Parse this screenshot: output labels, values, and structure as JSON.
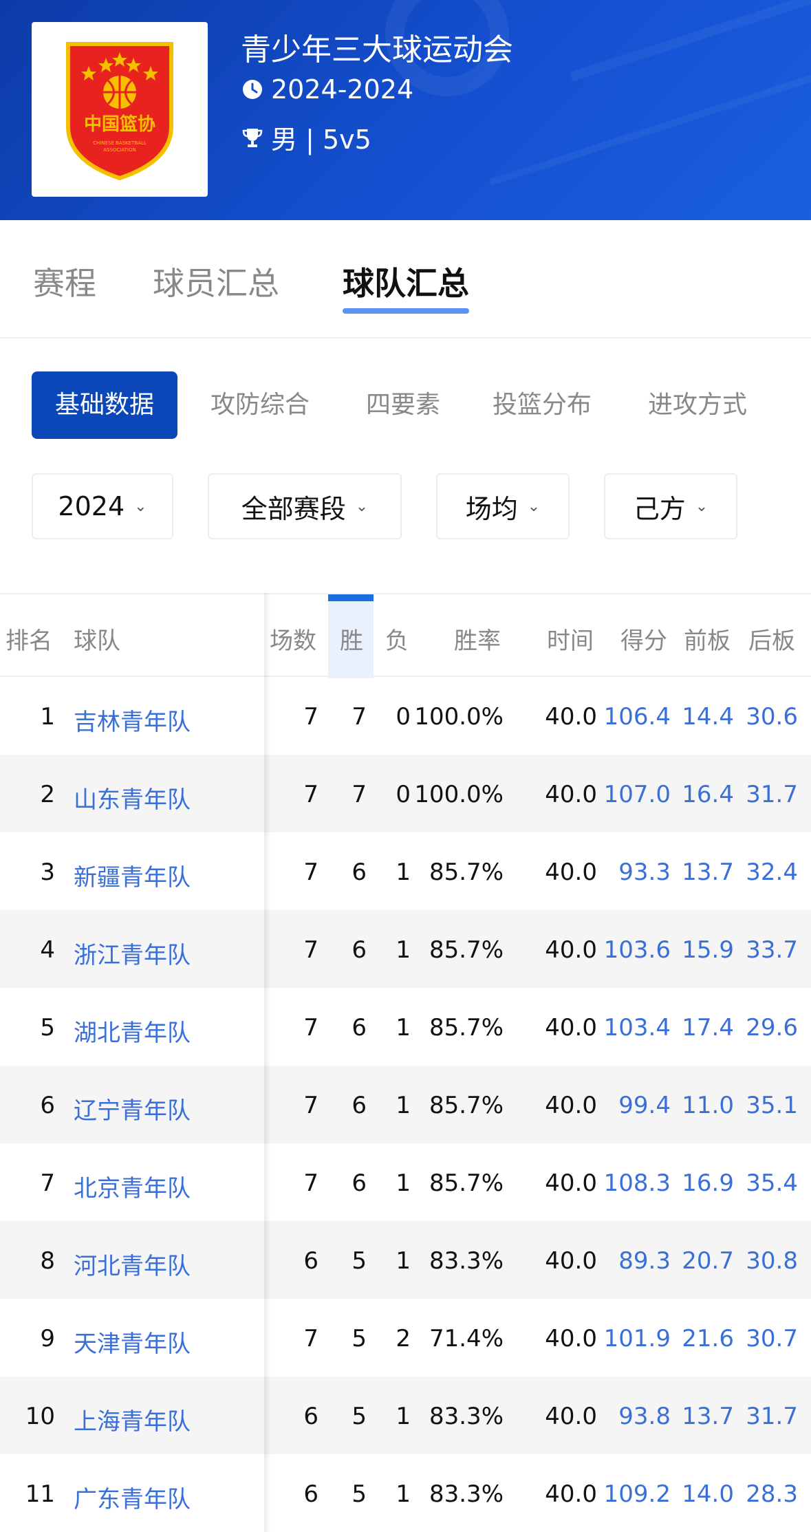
{
  "header": {
    "title": "青少年三大球运动会",
    "season": "2024-2024",
    "category": "男 | 5v5",
    "logo_text": "中国篮协",
    "logo_subtext": "CHINESE BASKETBALL ASSOCIATION"
  },
  "main_tabs": [
    {
      "label": "赛程",
      "active": false
    },
    {
      "label": "球员汇总",
      "active": false
    },
    {
      "label": "球队汇总",
      "active": true
    }
  ],
  "sub_tabs": [
    {
      "label": "基础数据",
      "active": true
    },
    {
      "label": "攻防综合",
      "active": false
    },
    {
      "label": "四要素",
      "active": false
    },
    {
      "label": "投篮分布",
      "active": false
    },
    {
      "label": "进攻方式",
      "active": false
    }
  ],
  "filters": [
    {
      "value": "2024"
    },
    {
      "value": "全部赛段"
    },
    {
      "value": "场均"
    },
    {
      "value": "己方"
    }
  ],
  "table": {
    "columns": [
      "排名",
      "球队",
      "场数",
      "胜",
      "负",
      "胜率",
      "时间",
      "得分",
      "前板",
      "后板"
    ],
    "rows": [
      [
        "1",
        "吉林青年队",
        "7",
        "7",
        "0",
        "100.0%",
        "40.0",
        "106.4",
        "14.4",
        "30.6"
      ],
      [
        "2",
        "山东青年队",
        "7",
        "7",
        "0",
        "100.0%",
        "40.0",
        "107.0",
        "16.4",
        "31.7"
      ],
      [
        "3",
        "新疆青年队",
        "7",
        "6",
        "1",
        "85.7%",
        "40.0",
        "93.3",
        "13.7",
        "32.4"
      ],
      [
        "4",
        "浙江青年队",
        "7",
        "6",
        "1",
        "85.7%",
        "40.0",
        "103.6",
        "15.9",
        "33.7"
      ],
      [
        "5",
        "湖北青年队",
        "7",
        "6",
        "1",
        "85.7%",
        "40.0",
        "103.4",
        "17.4",
        "29.6"
      ],
      [
        "6",
        "辽宁青年队",
        "7",
        "6",
        "1",
        "85.7%",
        "40.0",
        "99.4",
        "11.0",
        "35.1"
      ],
      [
        "7",
        "北京青年队",
        "7",
        "6",
        "1",
        "85.7%",
        "40.0",
        "108.3",
        "16.9",
        "35.4"
      ],
      [
        "8",
        "河北青年队",
        "6",
        "5",
        "1",
        "83.3%",
        "40.0",
        "89.3",
        "20.7",
        "30.8"
      ],
      [
        "9",
        "天津青年队",
        "7",
        "5",
        "2",
        "71.4%",
        "40.0",
        "101.9",
        "21.6",
        "30.7"
      ],
      [
        "10",
        "上海青年队",
        "6",
        "5",
        "1",
        "83.3%",
        "40.0",
        "93.8",
        "13.7",
        "31.7"
      ],
      [
        "11",
        "广东青年队",
        "6",
        "5",
        "1",
        "83.3%",
        "40.0",
        "109.2",
        "14.0",
        "28.3"
      ]
    ]
  },
  "colors": {
    "header_blue": "#1450d0",
    "active_tab": "#0b47b8",
    "link_blue": "#3a6fd8",
    "underline": "#3d82f0"
  }
}
